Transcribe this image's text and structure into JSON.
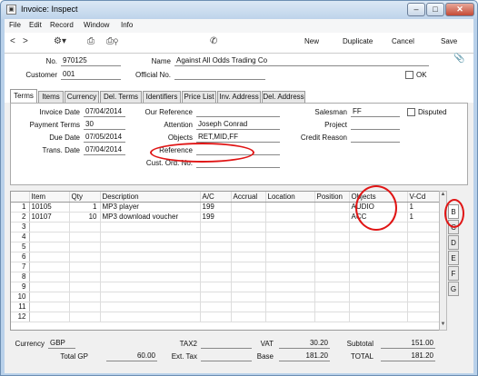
{
  "window": {
    "title": "Invoice: Inspect",
    "minimize": "–",
    "maximize": "□",
    "close": "✕"
  },
  "menu": [
    "File",
    "Edit",
    "Record",
    "Window",
    "Info"
  ],
  "toolbar": {
    "new": "New",
    "duplicate": "Duplicate",
    "cancel": "Cancel",
    "save": "Save"
  },
  "header": {
    "no_label": "No.",
    "no_value": "970125",
    "name_label": "Name",
    "name_value": "Against All Odds Trading Co",
    "customer_label": "Customer",
    "customer_value": "001",
    "official_label": "Official No.",
    "official_value": "",
    "ok_label": "OK"
  },
  "tabs": [
    "Terms",
    "Items",
    "Currency",
    "Del. Terms",
    "Identifiers",
    "Price List",
    "Inv. Address",
    "Del. Address"
  ],
  "terms": {
    "invoice_date_label": "Invoice Date",
    "invoice_date": "07/04/2014",
    "payment_terms_label": "Payment Terms",
    "payment_terms": "30",
    "due_date_label": "Due Date",
    "due_date": "07/05/2014",
    "trans_date_label": "Trans. Date",
    "trans_date": "07/04/2014",
    "our_ref_label": "Our Reference",
    "our_ref": "",
    "attention_label": "Attention",
    "attention": "Joseph Conrad",
    "objects_label": "Objects",
    "objects": "RET,MID,FF",
    "reference_label": "Reference",
    "reference": "",
    "cust_ord_label": "Cust. Ord. No.",
    "cust_ord": "",
    "salesman_label": "Salesman",
    "salesman": "FF",
    "disputed_label": "Disputed",
    "project_label": "Project",
    "project": "",
    "credit_reason_label": "Credit Reason",
    "credit_reason": ""
  },
  "grid": {
    "columns": [
      "",
      "Item",
      "Qty",
      "Description",
      "A/C",
      "Accrual",
      "Location",
      "Position",
      "Objects",
      "V-Cd"
    ],
    "rows": [
      [
        "1",
        "10105",
        "1",
        "MP3 player",
        "199",
        "",
        "",
        "",
        "AUDIO",
        "1"
      ],
      [
        "2",
        "10107",
        "10",
        "MP3 download voucher",
        "199",
        "",
        "",
        "",
        "ACC",
        "1"
      ],
      [
        "3",
        "",
        "",
        "",
        "",
        "",
        "",
        "",
        "",
        ""
      ],
      [
        "4",
        "",
        "",
        "",
        "",
        "",
        "",
        "",
        "",
        ""
      ],
      [
        "5",
        "",
        "",
        "",
        "",
        "",
        "",
        "",
        "",
        ""
      ],
      [
        "6",
        "",
        "",
        "",
        "",
        "",
        "",
        "",
        "",
        ""
      ],
      [
        "7",
        "",
        "",
        "",
        "",
        "",
        "",
        "",
        "",
        ""
      ],
      [
        "8",
        "",
        "",
        "",
        "",
        "",
        "",
        "",
        "",
        ""
      ],
      [
        "9",
        "",
        "",
        "",
        "",
        "",
        "",
        "",
        "",
        ""
      ],
      [
        "10",
        "",
        "",
        "",
        "",
        "",
        "",
        "",
        "",
        ""
      ],
      [
        "11",
        "",
        "",
        "",
        "",
        "",
        "",
        "",
        "",
        ""
      ],
      [
        "12",
        "",
        "",
        "",
        "",
        "",
        "",
        "",
        "",
        ""
      ]
    ],
    "flip_tabs": [
      "B",
      "C",
      "D",
      "E",
      "F",
      "G"
    ]
  },
  "footer": {
    "currency_label": "Currency",
    "currency": "GBP",
    "total_gp_label": "Total GP",
    "total_gp": "60.00",
    "tax2_label": "TAX2",
    "tax2": "",
    "ext_tax_label": "Ext. Tax",
    "ext_tax": "",
    "vat_label": "VAT",
    "vat": "30.20",
    "base_label": "Base",
    "base": "181.20",
    "subtotal_label": "Subtotal",
    "subtotal": "151.00",
    "total_label": "TOTAL",
    "total": "181.20"
  },
  "colors": {
    "highlight": "#e01515",
    "window_frame": "#b9d1ea"
  }
}
